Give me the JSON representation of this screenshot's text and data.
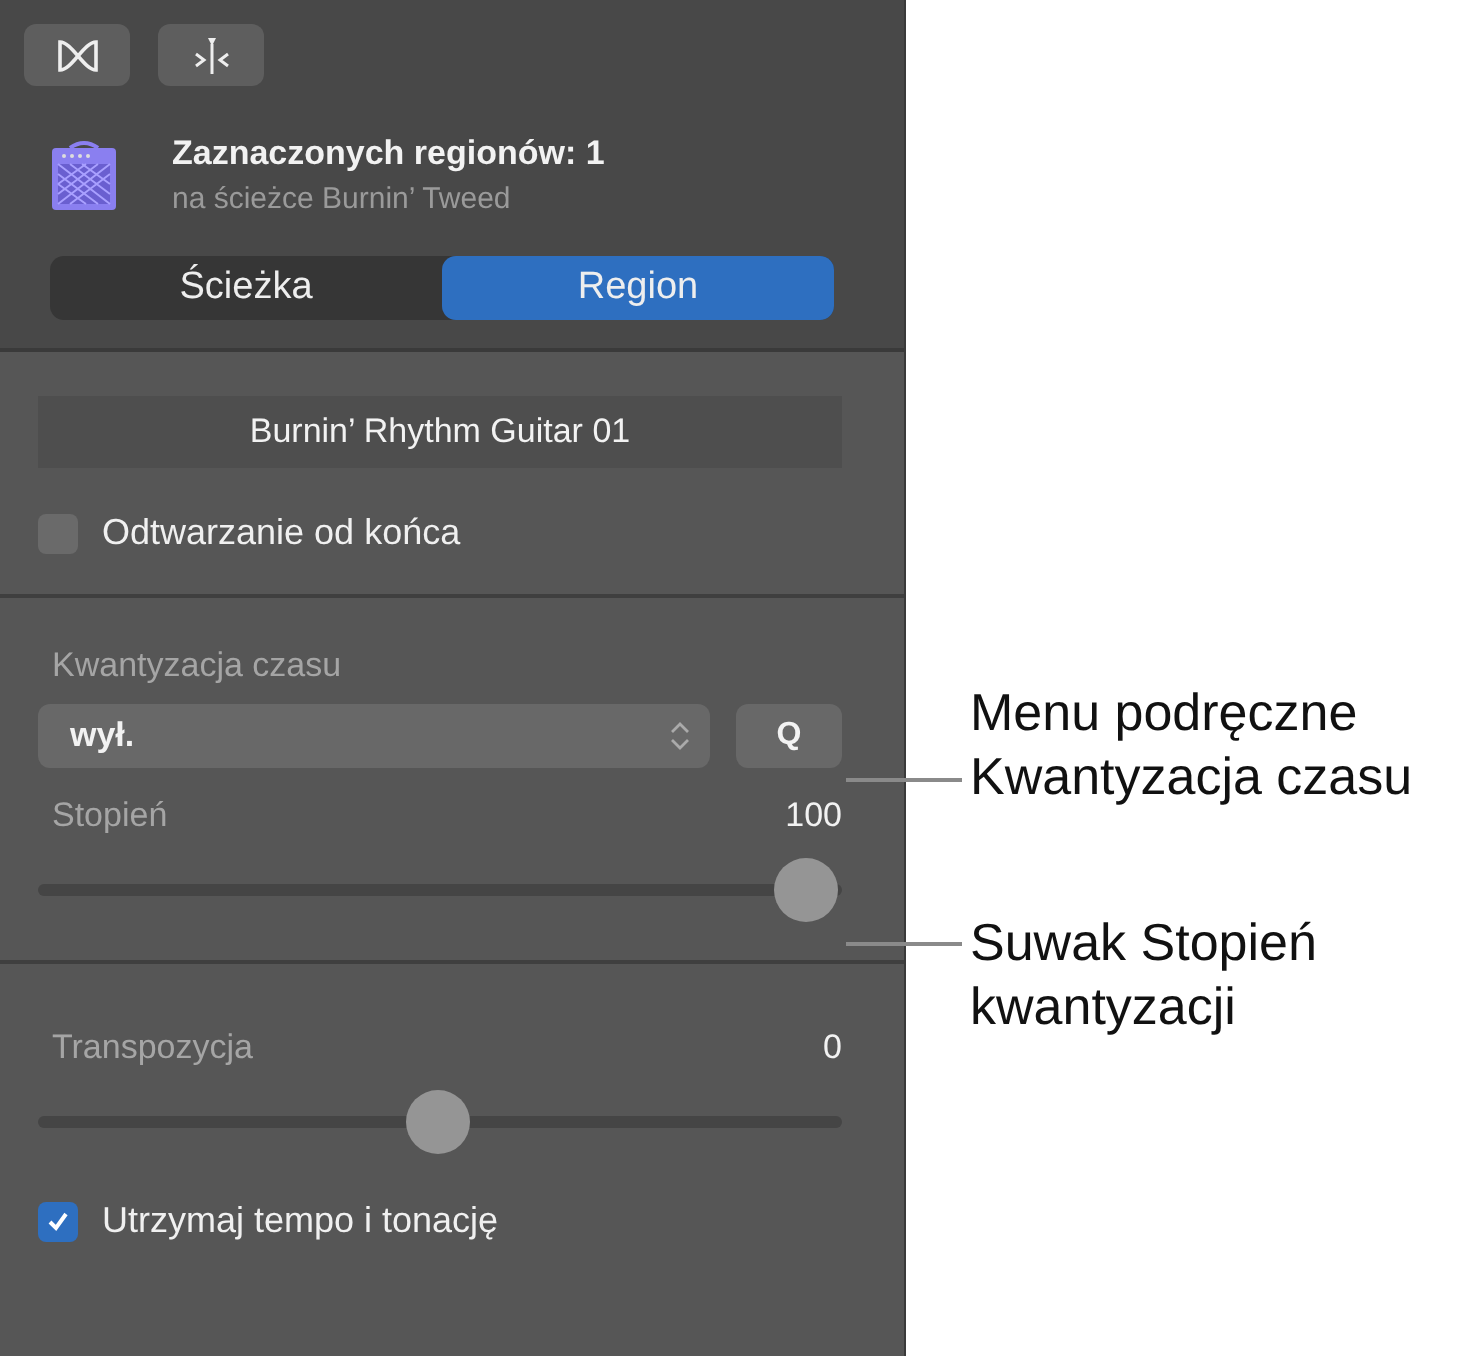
{
  "toolbar": [
    {
      "kind": "loop"
    },
    {
      "kind": "split"
    }
  ],
  "header": {
    "title": "Zaznaczonych regionów: 1",
    "subtitle": "na ścieżce Burnin’ Tweed"
  },
  "tabs": [
    {
      "label": "Ścieżka",
      "selected": false
    },
    {
      "label": "Region",
      "selected": true
    }
  ],
  "region_name": "Burnin’ Rhythm Guitar 01",
  "reverse": {
    "label": "Odtwarzanie od końca",
    "checked": false
  },
  "quantize": {
    "label": "Kwantyzacja czasu",
    "value": "wył.",
    "button": "Q"
  },
  "strength": {
    "label": "Stopień",
    "reading": "100",
    "level": 1
  },
  "transpose": {
    "label": "Transpozycja",
    "reading": "0",
    "level": 0.5
  },
  "keep": {
    "label": "Utrzymaj tempo i tonację",
    "checked": true
  },
  "callouts": [
    {
      "text": "Menu podręczne Kwantyzacja czasu"
    },
    {
      "text": "Suwak Stopień kwantyzacji"
    }
  ]
}
